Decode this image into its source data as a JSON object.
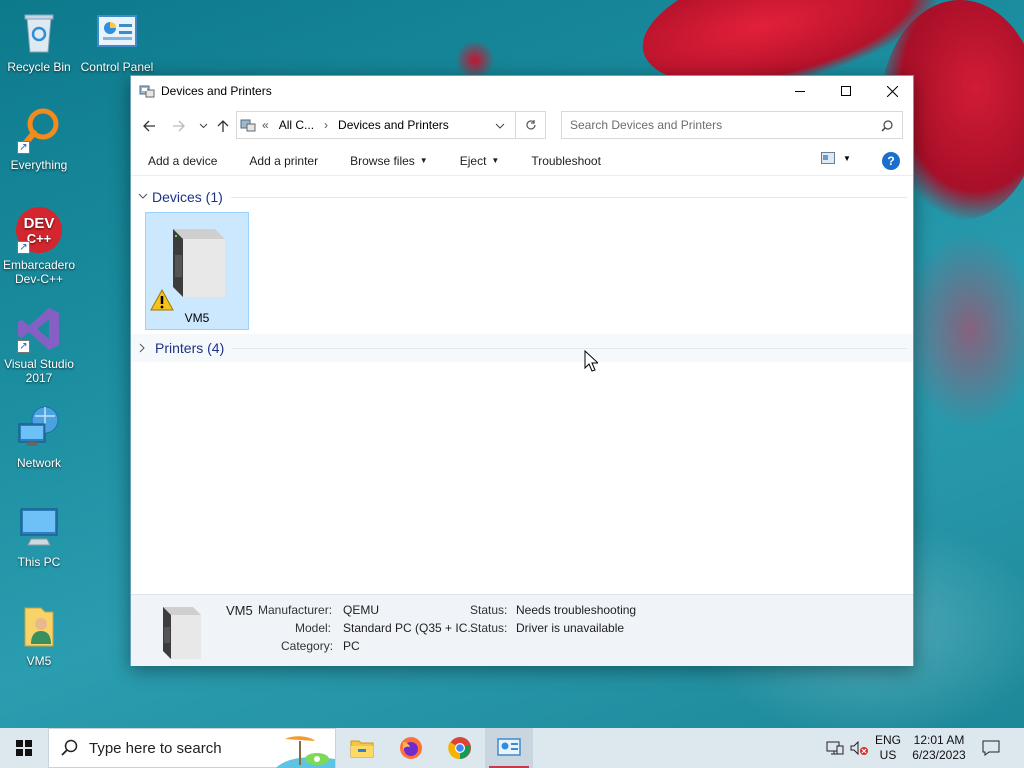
{
  "desktop": {
    "icons": [
      {
        "label": "Recycle Bin",
        "icon": "recycle-bin-icon"
      },
      {
        "label": "Control Panel",
        "icon": "control-panel-icon"
      },
      {
        "label": "Everything",
        "icon": "everything-search-icon"
      },
      {
        "label": "Embarcadero Dev-C++",
        "icon": "devcpp-icon"
      },
      {
        "label": "Visual Studio 2017",
        "icon": "visual-studio-icon"
      },
      {
        "label": "Network",
        "icon": "network-icon"
      },
      {
        "label": "This PC",
        "icon": "this-pc-icon"
      },
      {
        "label": "VM5",
        "icon": "user-folder-icon"
      }
    ]
  },
  "window": {
    "title": "Devices and Printers",
    "address": {
      "crumb_prefix": "«",
      "crumb_1": "All C...",
      "separator": "›",
      "crumb_2": "Devices and Printers"
    },
    "search_placeholder": "Search Devices and Printers",
    "commands": {
      "add_device": "Add a device",
      "add_printer": "Add a printer",
      "browse_files": "Browse files",
      "eject": "Eject",
      "troubleshoot": "Troubleshoot"
    },
    "groups": {
      "devices": "Devices (1)",
      "printers": "Printers (4)"
    },
    "device": {
      "name": "VM5"
    },
    "details": {
      "name": "VM5",
      "manufacturer_label": "Manufacturer:",
      "manufacturer": "QEMU",
      "model_label": "Model:",
      "model": "Standard PC (Q35 + IC...",
      "category_label": "Category:",
      "category": "PC",
      "status_label_1": "Status:",
      "status_1": "Needs troubleshooting",
      "status_label_2": "Status:",
      "status_2": "Driver is unavailable"
    }
  },
  "taskbar": {
    "search_placeholder": "Type here to search",
    "lang_1": "ENG",
    "lang_2": "US",
    "time": "12:01 AM",
    "date": "6/23/2023"
  },
  "colors": {
    "accent": "#0078d7",
    "selection": "#cce8ff",
    "group_text": "#1e3287",
    "help_blue": "#1a6fcc"
  }
}
